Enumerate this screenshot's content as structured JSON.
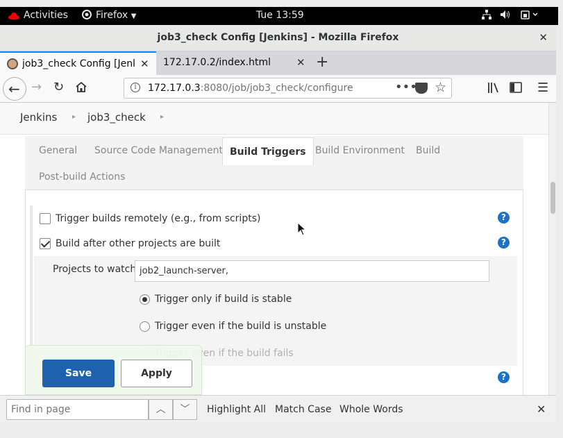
{
  "system_bar": {
    "activities": "Activities",
    "app_menu": "Firefox",
    "clock": "Tue 13:59"
  },
  "window": {
    "title": "job3_check Config [Jenkins] - Mozilla Firefox"
  },
  "tabs": [
    {
      "label": "job3_check Config [Jenkins]",
      "active": true
    },
    {
      "label": "172.17.0.2/index.html",
      "active": false
    }
  ],
  "urlbar": {
    "host": "172.17.0.3",
    "rest": ":8080/job/job3_check/configure"
  },
  "breadcrumbs": [
    "Jenkins",
    "job3_check"
  ],
  "config_tabs": [
    "General",
    "Source Code Management",
    "Build Triggers",
    "Build Environment",
    "Build",
    "Post-build Actions"
  ],
  "triggers": {
    "remote_label": "Trigger builds remotely (e.g., from scripts)",
    "remote_checked": false,
    "after_label": "Build after other projects are built",
    "after_checked": true,
    "projects_label": "Projects to watch",
    "projects_value": "job2_launch-server,",
    "radio_stable": "Trigger only if build is stable",
    "radio_unstable": "Trigger even if the build is unstable",
    "radio_fails": "Trigger even if the build fails",
    "selected_radio": "stable",
    "help_glyph": "?"
  },
  "buttons": {
    "save": "Save",
    "apply": "Apply"
  },
  "findbar": {
    "placeholder": "Find in page",
    "highlight_all": "Highlight All",
    "match_case": "Match Case",
    "whole_words": "Whole Words"
  },
  "colors": {
    "accent": "#1e62ad",
    "help_icon": "#1a73c8",
    "tab_highlight": "#0a84ff"
  }
}
